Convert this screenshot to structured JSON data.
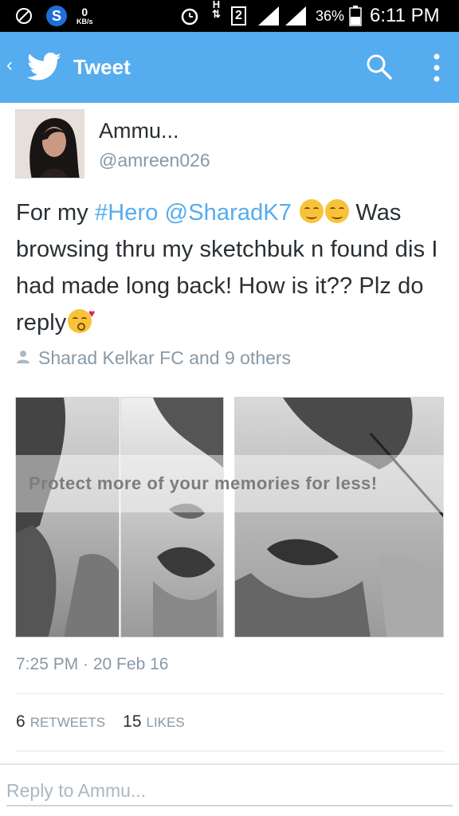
{
  "status_bar": {
    "kb_value": "0",
    "kb_unit": "KB/s",
    "sim_badge": "2",
    "h_label": "H",
    "battery": "36%",
    "time": "6:11 PM"
  },
  "app_bar": {
    "back_glyph": "‹",
    "title": "Tweet",
    "icons": [
      "back-arrow-icon",
      "twitter-bird-icon",
      "search-icon",
      "more-vertical-icon"
    ]
  },
  "tweet": {
    "author_name": "Ammu...",
    "author_handle": "@amreen026",
    "text_intro": "For my ",
    "hashtag": "#Hero",
    "mention": "@SharadK7",
    "text_rest_1": " Was browsing thru my sketchbuk n found dis I had made long back! How is it?? Plz do reply",
    "social_context": "Sharad Kelkar FC and 9 others",
    "media_watermark": "Protect more of your memories for less!",
    "timestamp": "7:25 PM · 20 Feb 16",
    "retweets_count": "6",
    "retweets_label": "RETWEETS",
    "likes_count": "15",
    "likes_label": "LIKES"
  },
  "reply": {
    "placeholder": "Reply to Ammu..."
  },
  "colors": {
    "brand": "#55acee",
    "text": "#292f33",
    "muted": "#8899a6"
  }
}
